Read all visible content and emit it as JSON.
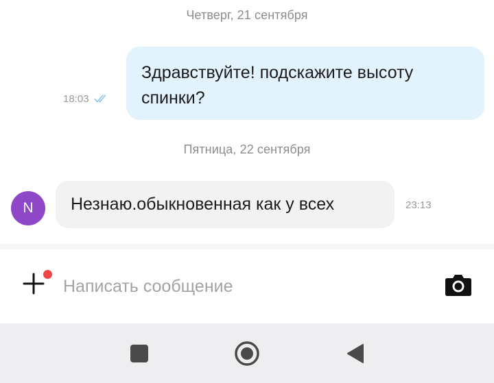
{
  "chat": {
    "date_separators": [
      "Четверг, 21 сентября",
      "Пятница, 22 сентября"
    ],
    "messages": [
      {
        "direction": "outgoing",
        "text": "Здравствуйте! подскажите высоту спинки?",
        "time": "18:03",
        "status_icon": "double-check-icon",
        "bubble_color": "#e3f3fd"
      },
      {
        "direction": "incoming",
        "avatar_initial": "N",
        "avatar_color": "#8d47c7",
        "text": "Незнаю.обыкновенная как у всех",
        "time": "23:13",
        "bubble_color": "#f2f2f3"
      }
    ]
  },
  "composer": {
    "placeholder": "Написать сообщение",
    "value": "",
    "attach_icon": "plus-icon",
    "notification_dot_color": "#ef4545",
    "camera_icon": "camera-icon"
  },
  "navbar": {
    "buttons": [
      "recent-apps-icon",
      "home-icon",
      "back-icon"
    ]
  }
}
